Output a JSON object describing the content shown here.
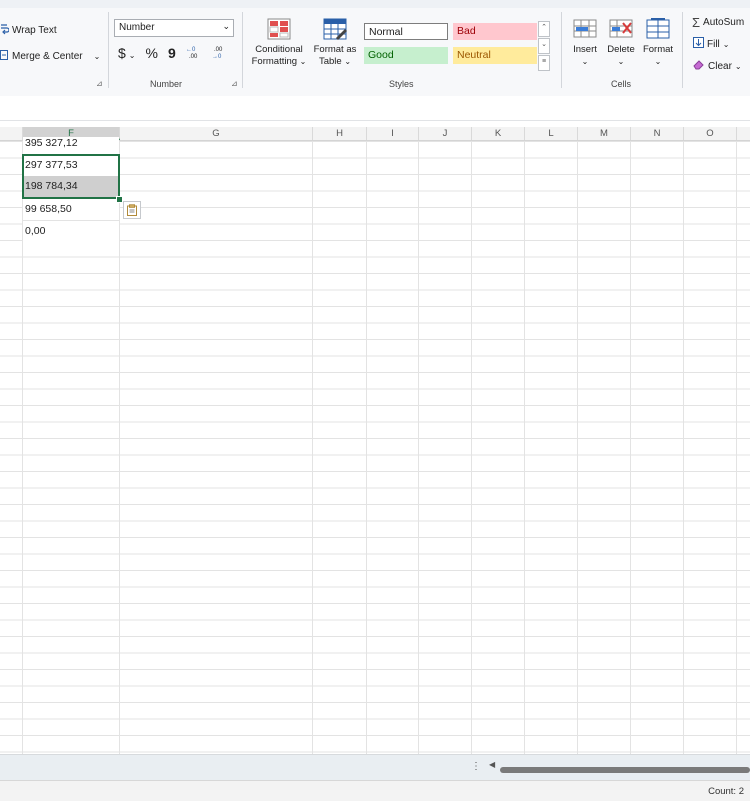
{
  "ribbon": {
    "alignment": {
      "wrap_text": "Wrap Text",
      "merge_center": "Merge & Center"
    },
    "number": {
      "format_value": "Number",
      "currency": "$",
      "percent": "%",
      "comma": "9",
      "inc_decimal": "←0 .00",
      "dec_decimal": ".00 →0",
      "group_label": "Number"
    },
    "styles": {
      "conditional_formatting": [
        "Conditional",
        "Formatting"
      ],
      "format_as_table": [
        "Format as",
        "Table"
      ],
      "normal": "Normal",
      "bad": "Bad",
      "good": "Good",
      "neutral": "Neutral",
      "group_label": "Styles",
      "colors": {
        "bad_bg": "#ffc7ce",
        "bad_fg": "#9c0006",
        "good_bg": "#c6efce",
        "good_fg": "#006100",
        "neutral_bg": "#ffeb9c",
        "neutral_fg": "#9c5700"
      }
    },
    "cells": {
      "insert": "Insert",
      "delete": "Delete",
      "format": "Format",
      "group_label": "Cells"
    },
    "editing": {
      "autosum": "AutoSum",
      "fill": "Fill",
      "clear": "Clear"
    }
  },
  "columns": [
    "F",
    "G",
    "H",
    "I",
    "J",
    "K",
    "L",
    "M",
    "N",
    "O"
  ],
  "selected_column": "F",
  "cells": [
    {
      "value": "395 327,12"
    },
    {
      "value": "297 377,53"
    },
    {
      "value": "198 784,34"
    },
    {
      "value": "99 658,50"
    },
    {
      "value": "0,00"
    }
  ],
  "status": {
    "count": "Count: 2"
  },
  "accent": "#217346"
}
